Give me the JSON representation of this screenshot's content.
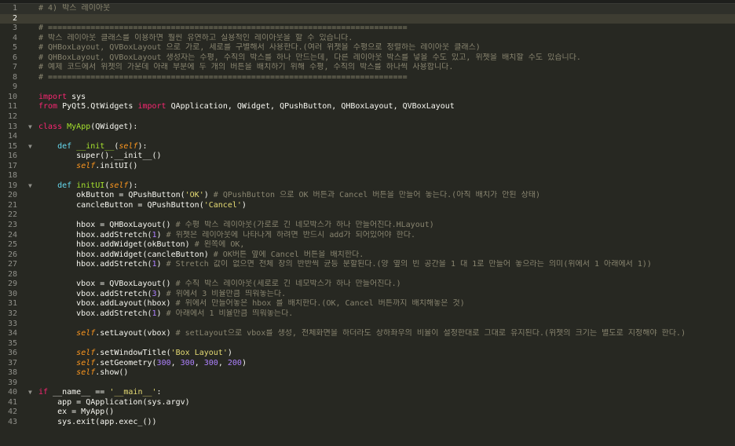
{
  "editor": {
    "lines": [
      {
        "n": "1",
        "fold": "",
        "tokens": [
          {
            "t": "# 4) 박스 레이아웃",
            "c": "comment"
          }
        ]
      },
      {
        "n": "2",
        "fold": "",
        "tokens": []
      },
      {
        "n": "3",
        "fold": "",
        "tokens": [
          {
            "t": "# ============================================================================",
            "c": "comment"
          }
        ]
      },
      {
        "n": "4",
        "fold": "",
        "tokens": [
          {
            "t": "# 박스 레이아웃 클래스를 이용하면 훨씬 유연하고 실용적인 레이아웃을 할 수 있습니다.",
            "c": "comment"
          }
        ]
      },
      {
        "n": "5",
        "fold": "",
        "tokens": [
          {
            "t": "# QHBoxLayout, QVBoxLayout 으로 가로, 세로를 구별해서 사용한다.(여러 위젯을 수평으로 정렬하는 레이아웃 클래스)",
            "c": "comment"
          }
        ]
      },
      {
        "n": "6",
        "fold": "",
        "tokens": [
          {
            "t": "# QHBoxLayout, QVBoxLayout 생성자는 수평, 수직의 박스를 하나 만드는데, 다른 레이아웃 박스를 넣을 수도 있고, 위젯을 배치할 수도 있습니다.",
            "c": "comment"
          }
        ]
      },
      {
        "n": "7",
        "fold": "",
        "tokens": [
          {
            "t": "# 예제 코드에서 위젯의 가운데 아래 부분에 두 개의 버튼을 배치하기 위해 수평, 수직의 박스를 하나씩 사용합니다.",
            "c": "comment"
          }
        ]
      },
      {
        "n": "8",
        "fold": "",
        "tokens": [
          {
            "t": "# ============================================================================",
            "c": "comment"
          }
        ]
      },
      {
        "n": "9",
        "fold": "",
        "tokens": []
      },
      {
        "n": "10",
        "fold": "",
        "tokens": [
          {
            "t": "import",
            "c": "keyword"
          },
          {
            "t": " sys",
            "c": "plain"
          }
        ]
      },
      {
        "n": "11",
        "fold": "",
        "tokens": [
          {
            "t": "from",
            "c": "keyword"
          },
          {
            "t": " PyQt5.QtWidgets ",
            "c": "plain"
          },
          {
            "t": "import",
            "c": "keyword"
          },
          {
            "t": " QApplication, QWidget, QPushButton, QHBoxLayout, QVBoxLayout",
            "c": "plain"
          }
        ]
      },
      {
        "n": "12",
        "fold": "",
        "tokens": []
      },
      {
        "n": "13",
        "fold": "▼",
        "tokens": [
          {
            "t": "class",
            "c": "keyword"
          },
          {
            "t": " ",
            "c": "plain"
          },
          {
            "t": "MyApp",
            "c": "func"
          },
          {
            "t": "(QWidget):",
            "c": "plain"
          }
        ]
      },
      {
        "n": "14",
        "fold": "",
        "tokens": []
      },
      {
        "n": "15",
        "fold": "▼",
        "tokens": [
          {
            "t": "    ",
            "c": "plain"
          },
          {
            "t": "def",
            "c": "builtin"
          },
          {
            "t": " ",
            "c": "plain"
          },
          {
            "t": "__init__",
            "c": "func"
          },
          {
            "t": "(",
            "c": "plain"
          },
          {
            "t": "self",
            "c": "param"
          },
          {
            "t": "):",
            "c": "plain"
          }
        ]
      },
      {
        "n": "16",
        "fold": "",
        "tokens": [
          {
            "t": "        super().__init__()",
            "c": "plain"
          }
        ]
      },
      {
        "n": "17",
        "fold": "",
        "tokens": [
          {
            "t": "        ",
            "c": "plain"
          },
          {
            "t": "self",
            "c": "self"
          },
          {
            "t": ".initUI()",
            "c": "plain"
          }
        ]
      },
      {
        "n": "18",
        "fold": "",
        "tokens": []
      },
      {
        "n": "19",
        "fold": "▼",
        "tokens": [
          {
            "t": "    ",
            "c": "plain"
          },
          {
            "t": "def",
            "c": "builtin"
          },
          {
            "t": " ",
            "c": "plain"
          },
          {
            "t": "initUI",
            "c": "func"
          },
          {
            "t": "(",
            "c": "plain"
          },
          {
            "t": "self",
            "c": "param"
          },
          {
            "t": "):",
            "c": "plain"
          }
        ]
      },
      {
        "n": "20",
        "fold": "",
        "tokens": [
          {
            "t": "        okButton = QPushButton(",
            "c": "plain"
          },
          {
            "t": "'OK'",
            "c": "string"
          },
          {
            "t": ") ",
            "c": "plain"
          },
          {
            "t": "# QPushButton 으로 OK 버튼과 Cancel 버튼을 만들어 놓는다.(아직 배치가 안된 상태)",
            "c": "comment"
          }
        ]
      },
      {
        "n": "21",
        "fold": "",
        "tokens": [
          {
            "t": "        cancleButton = QPushButton(",
            "c": "plain"
          },
          {
            "t": "'Cancel'",
            "c": "string"
          },
          {
            "t": ")",
            "c": "plain"
          }
        ]
      },
      {
        "n": "22",
        "fold": "",
        "tokens": []
      },
      {
        "n": "23",
        "fold": "",
        "tokens": [
          {
            "t": "        hbox = QHBoxLayout() ",
            "c": "plain"
          },
          {
            "t": "# 수평 박스 레이아웃(가로로 긴 네모박스가 하나 만들어진다.HLayout)",
            "c": "comment"
          }
        ]
      },
      {
        "n": "24",
        "fold": "",
        "tokens": [
          {
            "t": "        hbox.addStretch(",
            "c": "plain"
          },
          {
            "t": "1",
            "c": "number"
          },
          {
            "t": ") ",
            "c": "plain"
          },
          {
            "t": "# 위젯은 레이아웃에 나타나게 하려면 반드시 add가 되어있어야 한다.",
            "c": "comment"
          }
        ]
      },
      {
        "n": "25",
        "fold": "",
        "tokens": [
          {
            "t": "        hbox.addWidget(okButton) ",
            "c": "plain"
          },
          {
            "t": "# 왼쪽에 OK,",
            "c": "comment"
          }
        ]
      },
      {
        "n": "26",
        "fold": "",
        "tokens": [
          {
            "t": "        hbox.addWidget(cancleButton) ",
            "c": "plain"
          },
          {
            "t": "# OK버튼 옆에 Cancel 버튼을 배치한다.",
            "c": "comment"
          }
        ]
      },
      {
        "n": "27",
        "fold": "",
        "tokens": [
          {
            "t": "        hbox.addStretch(",
            "c": "plain"
          },
          {
            "t": "1",
            "c": "number"
          },
          {
            "t": ") ",
            "c": "plain"
          },
          {
            "t": "# Stretch 값이 없으면 전체 창의 반반씩 균등 분할된다.(양 옆의 빈 공간을 1 대 1로 만들어 놓으라는 의미(위에서 1 아래에서 1))",
            "c": "comment"
          }
        ]
      },
      {
        "n": "28",
        "fold": "",
        "tokens": []
      },
      {
        "n": "29",
        "fold": "",
        "tokens": [
          {
            "t": "        vbox = QVBoxLayout() ",
            "c": "plain"
          },
          {
            "t": "# 수직 박스 레이아웃(세로로 긴 네모박스가 하나 만들어진다.)",
            "c": "comment"
          }
        ]
      },
      {
        "n": "30",
        "fold": "",
        "tokens": [
          {
            "t": "        vbox.addStretch(",
            "c": "plain"
          },
          {
            "t": "3",
            "c": "number"
          },
          {
            "t": ") ",
            "c": "plain"
          },
          {
            "t": "# 위에서 3 비율만큼 띄워놓는다.",
            "c": "comment"
          }
        ]
      },
      {
        "n": "31",
        "fold": "",
        "tokens": [
          {
            "t": "        vbox.addLayout(hbox) ",
            "c": "plain"
          },
          {
            "t": "# 위에서 만들어놓은 hbox 를 배치한다.(OK, Cancel 버튼까지 배치해놓은 것)",
            "c": "comment"
          }
        ]
      },
      {
        "n": "32",
        "fold": "",
        "tokens": [
          {
            "t": "        vbox.addStretch(",
            "c": "plain"
          },
          {
            "t": "1",
            "c": "number"
          },
          {
            "t": ") ",
            "c": "plain"
          },
          {
            "t": "# 아래에서 1 비율만큼 띄워놓는다.",
            "c": "comment"
          }
        ]
      },
      {
        "n": "33",
        "fold": "",
        "tokens": []
      },
      {
        "n": "34",
        "fold": "",
        "tokens": [
          {
            "t": "        ",
            "c": "plain"
          },
          {
            "t": "self",
            "c": "self"
          },
          {
            "t": ".setLayout(vbox) ",
            "c": "plain"
          },
          {
            "t": "# setLayout으로 vbox를 생성, 전체화면을 하더라도 상하좌우의 비율이 설정한대로 그대로 유지된다.(위젯의 크기는 별도로 지정해야 한다.)",
            "c": "comment"
          }
        ]
      },
      {
        "n": "35",
        "fold": "",
        "tokens": []
      },
      {
        "n": "36",
        "fold": "",
        "tokens": [
          {
            "t": "        ",
            "c": "plain"
          },
          {
            "t": "self",
            "c": "self"
          },
          {
            "t": ".setWindowTitle(",
            "c": "plain"
          },
          {
            "t": "'Box Layout'",
            "c": "string"
          },
          {
            "t": ")",
            "c": "plain"
          }
        ]
      },
      {
        "n": "37",
        "fold": "",
        "tokens": [
          {
            "t": "        ",
            "c": "plain"
          },
          {
            "t": "self",
            "c": "self"
          },
          {
            "t": ".setGeometry(",
            "c": "plain"
          },
          {
            "t": "300",
            "c": "number"
          },
          {
            "t": ", ",
            "c": "plain"
          },
          {
            "t": "300",
            "c": "number"
          },
          {
            "t": ", ",
            "c": "plain"
          },
          {
            "t": "300",
            "c": "number"
          },
          {
            "t": ", ",
            "c": "plain"
          },
          {
            "t": "200",
            "c": "number"
          },
          {
            "t": ")",
            "c": "plain"
          }
        ]
      },
      {
        "n": "38",
        "fold": "",
        "tokens": [
          {
            "t": "        ",
            "c": "plain"
          },
          {
            "t": "self",
            "c": "self"
          },
          {
            "t": ".show()",
            "c": "plain"
          }
        ]
      },
      {
        "n": "39",
        "fold": "",
        "tokens": []
      },
      {
        "n": "40",
        "fold": "▼",
        "tokens": [
          {
            "t": "if",
            "c": "keyword"
          },
          {
            "t": " __name__ == ",
            "c": "plain"
          },
          {
            "t": "'__main__'",
            "c": "string"
          },
          {
            "t": ":",
            "c": "plain"
          }
        ]
      },
      {
        "n": "41",
        "fold": "",
        "tokens": [
          {
            "t": "    app = QApplication(sys.argv)",
            "c": "plain"
          }
        ]
      },
      {
        "n": "42",
        "fold": "",
        "tokens": [
          {
            "t": "    ex = MyApp()",
            "c": "plain"
          }
        ]
      },
      {
        "n": "43",
        "fold": "",
        "tokens": [
          {
            "t": "    sys.exit(app.exec_())",
            "c": "plain"
          }
        ]
      }
    ],
    "current_line": "2"
  }
}
